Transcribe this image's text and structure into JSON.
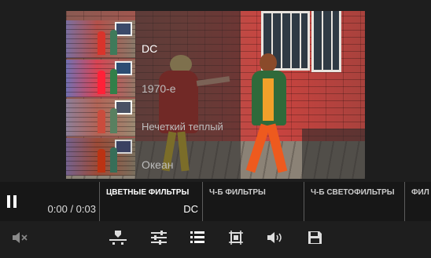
{
  "player": {
    "time": "0:00 / 0:03"
  },
  "filter_menu": {
    "items": [
      {
        "label": "DC",
        "selected": true
      },
      {
        "label": "1970-е",
        "selected": false
      },
      {
        "label": "Нечеткий теплый",
        "selected": false
      },
      {
        "label": "Океан",
        "selected": false
      }
    ]
  },
  "filter_tabs": [
    {
      "title": "ЦВЕТНЫЕ ФИЛЬТРЫ",
      "value": "DC",
      "active": true
    },
    {
      "title": "Ч-Б ФИЛЬТРЫ",
      "value": "",
      "active": false
    },
    {
      "title": "Ч-Б СВЕТОФИЛЬТРЫ",
      "value": "",
      "active": false
    },
    {
      "title": "ФИЛ",
      "value": "",
      "active": false
    }
  ],
  "toolbar": {
    "icons": [
      "mute-icon",
      "trim-icon",
      "adjust-sliders-icon",
      "filter-list-icon",
      "crop-icon",
      "volume-icon",
      "save-icon"
    ]
  },
  "colors": {
    "background": "#1e1e1e",
    "controls_bg": "#171717",
    "accent_text": "#ffffff"
  }
}
